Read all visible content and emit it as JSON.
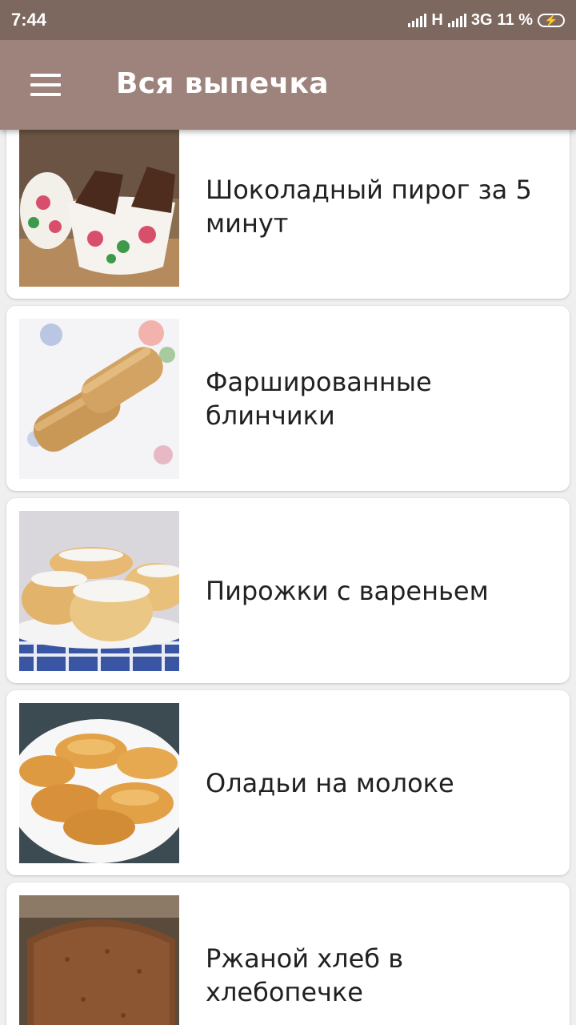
{
  "status_bar": {
    "time": "7:44",
    "network_1": "H",
    "network_2": "3G",
    "battery": "11 %"
  },
  "app_bar": {
    "title": "Вся выпечка"
  },
  "recipes": [
    {
      "title": "Шоколадный пирог за 5 минут"
    },
    {
      "title": "Фаршированные блинчики"
    },
    {
      "title": "Пирожки с вареньем"
    },
    {
      "title": "Оладьи на молоке"
    },
    {
      "title": "Ржаной хлеб в хлебопечке"
    }
  ],
  "colors": {
    "status_bar": "#7d6860",
    "app_bar": "#9d837b",
    "background": "#efefef",
    "card": "#ffffff",
    "text": "#212121"
  }
}
